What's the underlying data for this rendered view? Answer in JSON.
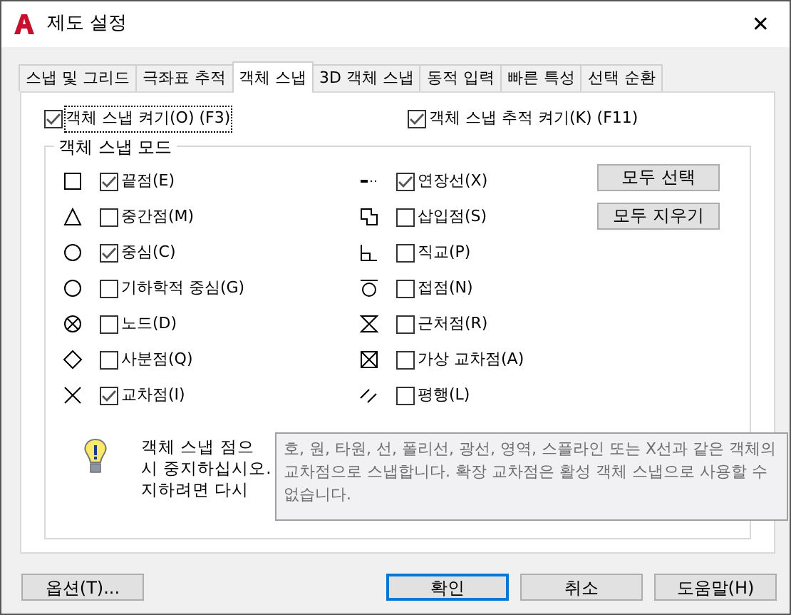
{
  "window": {
    "title": "제도 설정",
    "close": "✕"
  },
  "tabs": [
    {
      "label": "스냅 및 그리드",
      "selected": false
    },
    {
      "label": "극좌표 추적",
      "selected": false
    },
    {
      "label": "객체 스냅",
      "selected": true
    },
    {
      "label": "3D 객체 스냅",
      "selected": false
    },
    {
      "label": "동적 입력",
      "selected": false
    },
    {
      "label": "빠른 특성",
      "selected": false
    },
    {
      "label": "선택 순환",
      "selected": false
    }
  ],
  "toggles": [
    {
      "label": "객체 스냅 켜기(O) (F3)",
      "checked": true,
      "focused": true
    },
    {
      "label": "객체 스냅 추적 켜기(K) (F11)",
      "checked": true,
      "focused": false
    }
  ],
  "snap_modes": {
    "title": "객체 스냅 모드",
    "left": [
      {
        "label": "끝점(E)",
        "checked": true
      },
      {
        "label": "중간점(M)",
        "checked": false
      },
      {
        "label": "중심(C)",
        "checked": true
      },
      {
        "label": "기하학적 중심(G)",
        "checked": false
      },
      {
        "label": "노드(D)",
        "checked": false
      },
      {
        "label": "사분점(Q)",
        "checked": false
      },
      {
        "label": "교차점(I)",
        "checked": true
      }
    ],
    "right": [
      {
        "label": "연장선(X)",
        "checked": true
      },
      {
        "label": "삽입점(S)",
        "checked": false
      },
      {
        "label": "직교(P)",
        "checked": false
      },
      {
        "label": "접점(N)",
        "checked": false
      },
      {
        "label": "근처점(R)",
        "checked": false
      },
      {
        "label": "가상 교차점(A)",
        "checked": false
      },
      {
        "label": "평행(L)",
        "checked": false
      }
    ],
    "buttons": [
      "모두 선택",
      "모두 지우기"
    ],
    "info_lines": [
      "객체 스냅 점으",
      "시 중지하십시오.",
      "지하려면 다시"
    ]
  },
  "tooltip": "호, 원, 타원, 선, 폴리선, 광선, 영역, 스플라인 또는 X선과 같은 객체의 교차점으로 스냅합니다. 확장 교차점은 활성 객체 스냅으로 사용할 수 없습니다.",
  "footer": [
    {
      "label": "옵션(T)...",
      "default": false
    },
    {
      "label": "확인",
      "default": true
    },
    {
      "label": "취소",
      "default": false
    },
    {
      "label": "도움말(H)",
      "default": false
    }
  ]
}
